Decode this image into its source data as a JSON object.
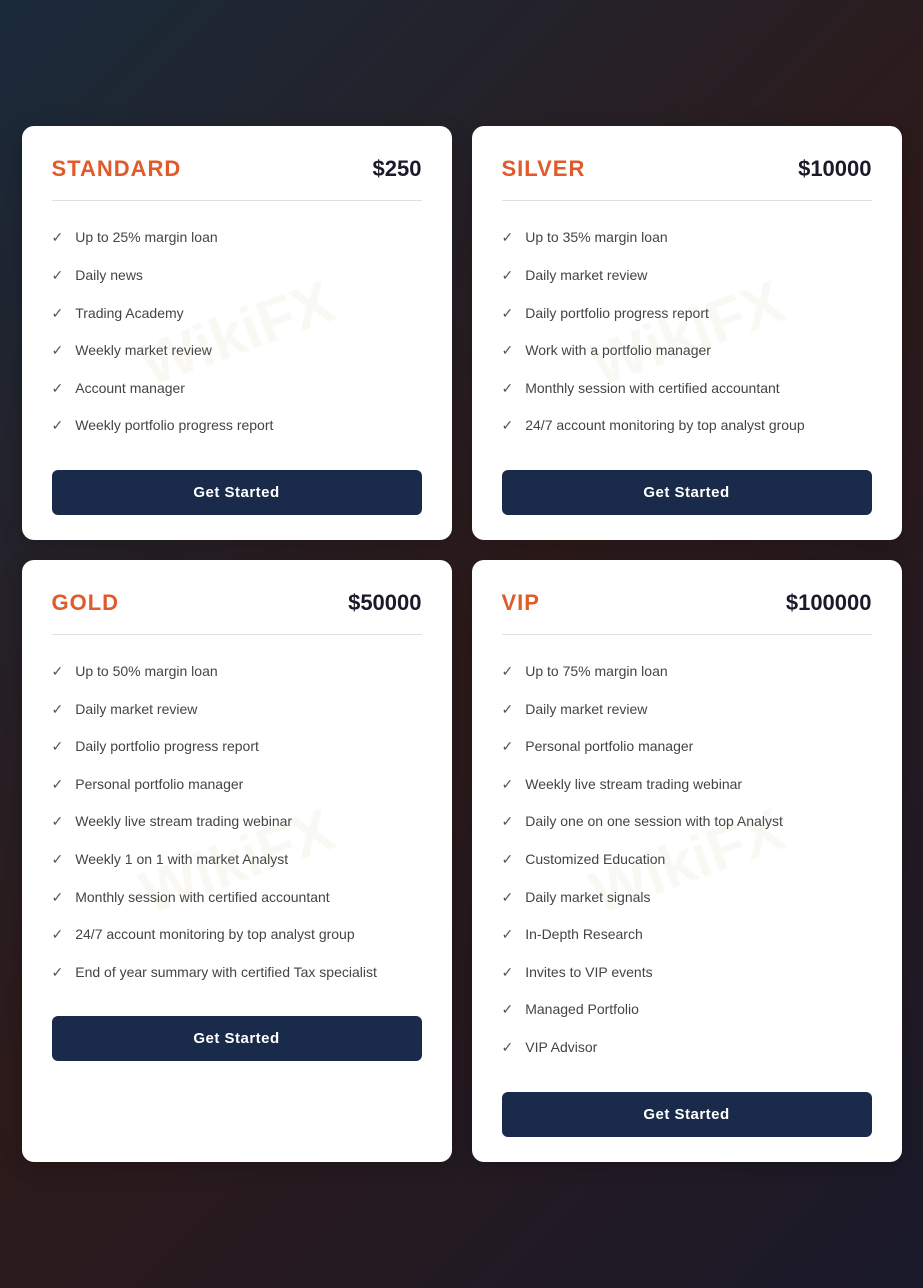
{
  "cards": [
    {
      "id": "standard",
      "title": "STANDARD",
      "price": "$250",
      "features": [
        "Up to 25% margin loan",
        "Daily news",
        "Trading Academy",
        "Weekly market review",
        "Account manager",
        "Weekly portfolio progress report"
      ],
      "button": "Get Started"
    },
    {
      "id": "silver",
      "title": "SILVER",
      "price": "$10000",
      "features": [
        "Up to 35% margin loan",
        "Daily market review",
        "Daily portfolio progress report",
        "Work with a portfolio manager",
        "Monthly session with certified accountant",
        "24/7 account monitoring by top analyst group"
      ],
      "button": "Get Started"
    },
    {
      "id": "gold",
      "title": "GOLD",
      "price": "$50000",
      "features": [
        "Up to 50% margin loan",
        "Daily market review",
        "Daily portfolio progress report",
        "Personal portfolio manager",
        "Weekly live stream trading webinar",
        "Weekly 1 on 1 with market Analyst",
        "Monthly session with certified accountant",
        "24/7 account monitoring by top analyst group",
        "End of year summary with certified Tax specialist"
      ],
      "button": "Get Started"
    },
    {
      "id": "vip",
      "title": "VIP",
      "price": "$100000",
      "features": [
        "Up to 75% margin loan",
        "Daily market review",
        "Personal portfolio manager",
        "Weekly live stream trading webinar",
        "Daily one on one session with top Analyst",
        "Customized Education",
        "Daily market signals",
        "In-Depth Research",
        "Invites to VIP events",
        "Managed Portfolio",
        "VIP Advisor"
      ],
      "button": "Get Started"
    }
  ]
}
